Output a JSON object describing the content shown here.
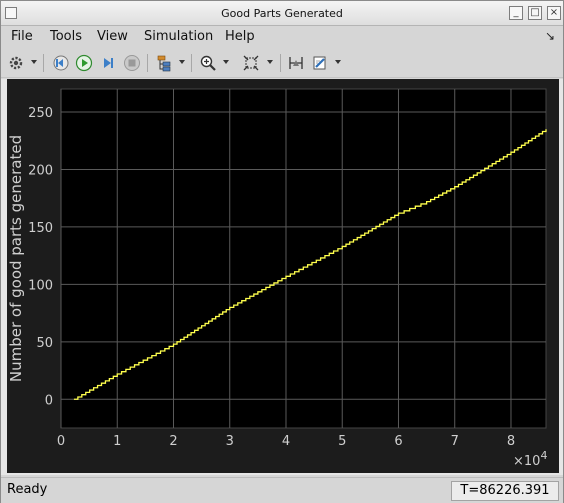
{
  "window": {
    "title": "Good Parts Generated"
  },
  "menu": {
    "file": "File",
    "tools": "Tools",
    "view": "View",
    "simulation": "Simulation",
    "help": "Help"
  },
  "toolbar": {
    "icons": [
      "settings-icon",
      "step-back-icon",
      "run-icon",
      "step-forward-icon",
      "stop-icon",
      "signal-hierarchy-icon",
      "zoom-icon",
      "fit-to-view-icon",
      "cursor-measure-icon",
      "style-icon"
    ]
  },
  "status": {
    "text": "Ready",
    "time": "T=86226.391"
  },
  "colors": {
    "plot_bg": "#000000",
    "figure_bg": "#1c1c1c",
    "grid": "#5a5a5a",
    "axis_text": "#cfcfcf",
    "line": "#ffff4d"
  },
  "chart_data": {
    "type": "line",
    "title": "",
    "xlabel": "",
    "ylabel": "Number of good parts generated",
    "x_exponent_label": "×10",
    "x_exponent": "4",
    "xlim": [
      0,
      86226
    ],
    "ylim": [
      -25,
      270
    ],
    "x_ticks": [
      0,
      10000,
      20000,
      30000,
      40000,
      50000,
      60000,
      70000,
      80000
    ],
    "x_tick_labels": [
      "0",
      "1",
      "2",
      "3",
      "4",
      "5",
      "6",
      "7",
      "8"
    ],
    "y_ticks": [
      0,
      50,
      100,
      150,
      200,
      250
    ],
    "y_tick_labels": [
      "0",
      "50",
      "100",
      "150",
      "200",
      "250"
    ],
    "grid": true,
    "series": [
      {
        "x": [
          2300,
          10000,
          20000,
          30000,
          40000,
          50000,
          60000,
          65000,
          70000,
          80000,
          86226
        ],
        "values": [
          0,
          22,
          48,
          80,
          107,
          133,
          162,
          172,
          185,
          215,
          235
        ]
      }
    ]
  }
}
